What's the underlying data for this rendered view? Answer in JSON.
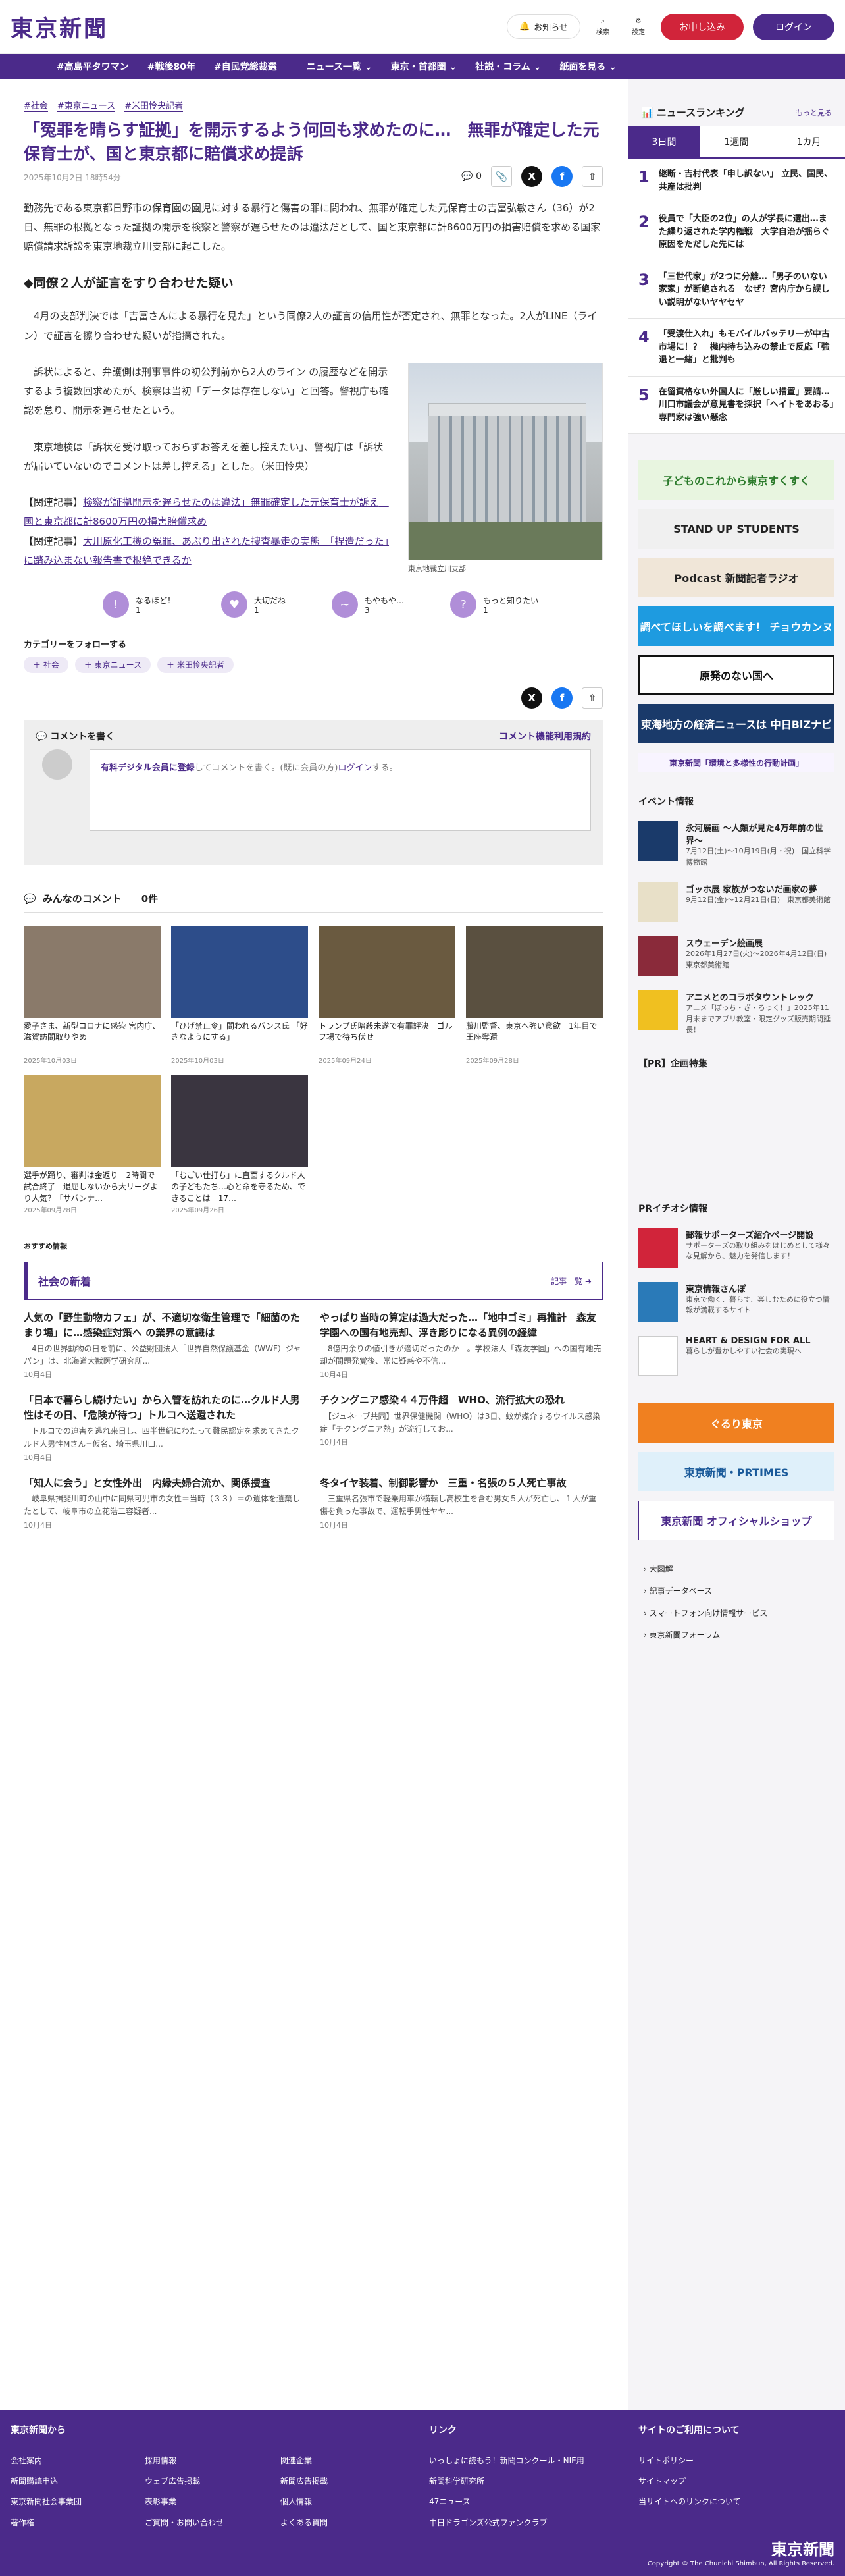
{
  "header": {
    "logo": "東京新聞",
    "notify": "お知らせ",
    "search": "検索",
    "settings": "設定",
    "subscribe": "お申し込み",
    "login": "ログイン"
  },
  "nav": [
    "#高島平タワマン",
    "#戦後80年",
    "#自民党総裁選",
    "ニュース一覧",
    "東京・首都圏",
    "社説・コラム",
    "紙面を見る"
  ],
  "article": {
    "tags": [
      "#社会",
      "#東京ニュース",
      "#米田怜央記者"
    ],
    "title": "「冤罪を晴らす証拠」を開示するよう何回も求めたのに…　無罪が確定した元保育士が、国と東京都に賠償求め提訴",
    "date": "2025年10月2日 18時54分",
    "comments_count": "0",
    "p1": "勤務先である東京都日野市の保育園の園児に対する暴行と傷害の罪に問われ、無罪が確定した元保育士の吉冨弘敏さん（36）が2日、無罪の根拠となった証拠の開示を検察と警察が遅らせたのは違法だとして、国と東京都に計8600万円の損害賠償を求める国家賠償請求訴訟を東京地裁立川支部に起こした。",
    "h2": "◆同僚２人が証言をすり合わせた疑い",
    "p2": "　4月の支部判決では「吉冨さんによる暴行を見た」という同僚2人の証言の信用性が否定され、無罪となった。2人がLINE（ライン）で証言を擦り合わせた疑いが指摘された。",
    "p3": "　訴状によると、弁護側は刑事事件の初公判前から2人のライン の履歴などを開示するよう複数回求めたが、検察は当初「データは存在しない」と回答。警視庁も確認を怠り、開示を遅らせたという。",
    "p4": "　東京地検は「訴状を受け取っておらずお答えを差し控えたい」、警視庁は「訴状が届いていないのでコメントは差し控える」とした。（米田怜央）",
    "caption": "東京地裁立川支部",
    "related_label1": "【関連記事】",
    "related1": "検察が証拠開示を遅らせたのは違法」無罪確定した元保育士が訴え　国と東京都に計8600万円の損害賠償求め",
    "related_label2": "【関連記事】",
    "related2": "大川原化工機の冤罪、あぶり出された捜査暴走の実態　「捏造だった」に踏み込まない報告書で根絶できるか"
  },
  "reactions": [
    {
      "label": "なるほど！",
      "count": "1",
      "icon": "!"
    },
    {
      "label": "大切だね",
      "count": "1",
      "icon": "♥"
    },
    {
      "label": "もやもや…",
      "count": "3",
      "icon": "~"
    },
    {
      "label": "もっと知りたい",
      "count": "1",
      "icon": "?"
    }
  ],
  "category": {
    "heading": "カテゴリーをフォローする",
    "chips": [
      "＋ 社会",
      "＋ 東京ニュース",
      "＋ 米田怜央記者"
    ]
  },
  "comment": {
    "heading": "コメントを書く",
    "policy": "コメント機能利用規約",
    "placeholder_link": "有料デジタル会員に登録",
    "placeholder_rest": "してコメントを書く。(既に会員の方)",
    "login": "ログイン",
    "end": "する。"
  },
  "all_comments": {
    "heading": "みんなのコメント",
    "count": "0件"
  },
  "cards": [
    {
      "title": "愛子さま、新型コロナに感染 宮内庁、滋賀訪問取りやめ",
      "date": "2025年10月03日",
      "color": "#8a7a6a"
    },
    {
      "title": "「ひげ禁止令」問われるバンス氏 「好きなようにする」",
      "date": "2025年10月03日",
      "color": "#2d4d8a"
    },
    {
      "title": "トランプ氏暗殺未遂で有罪評決　ゴルフ場で待ち伏せ",
      "date": "2025年09月24日",
      "color": "#6a5a40"
    },
    {
      "title": "藤川監督、東京へ強い意欲　1年目で王座奪還",
      "date": "2025年09月28日",
      "color": "#5a5040"
    },
    {
      "title": "選手が踊り、審判は金返り　2時間で試合終了　退屈しないから大リーグより人気？「サバンナ…",
      "date": "2025年09月28日",
      "color": "#c8a860"
    },
    {
      "title": "「むごい仕打ち」に直面するクルド人の子どもたち…心と命を守るため、できることは　17…",
      "date": "2025年09月26日",
      "color": "#3a3540"
    }
  ],
  "recommend_label": "おすすめ情報",
  "latest": {
    "heading": "社会の新着",
    "more": "記事一覧",
    "items": [
      {
        "title": "人気の「野生動物カフェ」が、不適切な衛生管理で「細菌のたまり場」に…感染症対策へ の業界の意識は",
        "sub": "　4日の世界動物の日を前に、公益財団法人「世界自然保護基金（WWF）ジャパン」は、北海道大獣医学研究所...",
        "date": "10月4日"
      },
      {
        "title": "やっぱり当時の算定は過大だった…「地中ゴミ」再推計　森友学園への国有地売却、浮き彫りになる異例の経緯",
        "sub": "　8億円余りの値引きが適切だったのか―。学校法人「森友学園」への国有地売却が問題発覚後、常に疑惑や不信...",
        "date": "10月4日"
      },
      {
        "title": "「日本で暮らし続けたい」から入管を訪れたのに…クルド人男性はその日、「危険が待つ」トルコへ送還された",
        "sub": "　トルコでの迫害を逃れ来日し、四半世紀にわたって難民認定を求めてきたクルド人男性Mさん=仮名、埼玉県川口...",
        "date": "10月4日"
      },
      {
        "title": "チクングニア感染４４万件超　WHO、流行拡大の恐れ",
        "sub": "　【ジュネーブ共同】世界保健機関（WHO）は3日、蚊が媒介するウイルス感染症「チクングニア熱」が流行してお...",
        "date": "10月4日"
      },
      {
        "title": "「知人に会う」と女性外出　内縁夫婦合流か、関係捜査",
        "sub": "　岐阜県揖斐川町の山中に同県可児市の女性＝当時（３３）＝の遺体を遺棄したとして、岐阜市の立花浩二容疑者...",
        "date": "10月4日"
      },
      {
        "title": "冬タイヤ装着、制御影響か　三重・名張の５人死亡事故",
        "sub": "　三重県名張市で軽乗用車が横転し高校生を含む男女５人が死亡し、１人が重傷を負った事故で、運転手男性ヤヤ...",
        "date": "10月4日"
      }
    ]
  },
  "sidebar": {
    "ranking_title": "ニュースランキング",
    "ranking_more": "もっと見る",
    "tabs": [
      "3日間",
      "1週間",
      "1カ月"
    ],
    "ranks": [
      "継断・吉村代表「申し訳ない」 立民、国民、共産は批判",
      "役員で「大臣の2位」の人が学長に選出…また繰り返された学内権戦　大学自治が揺らぐ原因をただした先には",
      "「三世代家」が2つに分離…「男子のいない家家」が断絶される　なぜ？宮内庁から誤しい説明がないヤヤセヤ",
      "「受渡仕入れ」もモバイルバッテリーが中古市場に！？　機内持ち込みの禁止で反応「強退と一緒」と批判も",
      "在留資格ない外国人に「厳しい措置」要請…川口市議会が意見書を採択「ヘイトをあおる」専門家は強い懸念"
    ],
    "banners": [
      {
        "text": "子どものこれから東京すくすく",
        "bg": "#e8f5e0",
        "fg": "#2a7a2a"
      },
      {
        "text": "STAND UP STUDENTS",
        "bg": "#f0f0f0",
        "fg": "#222"
      },
      {
        "text": "Podcast 新聞記者ラジオ",
        "bg": "#f0e6d8",
        "fg": "#222"
      },
      {
        "text": "調べてほしいを調べます！ チョウカンヌ",
        "bg": "#1e9be0",
        "fg": "#fff"
      },
      {
        "text": "原発のない国へ",
        "bg": "#fff",
        "fg": "#111"
      },
      {
        "text": "東海地方の経済ニュースは 中日BiZナビ",
        "bg": "#1a3a6a",
        "fg": "#fff"
      },
      {
        "text": "東京新聞「環境と多様性の行動計画」",
        "bg": "#f8f4ff",
        "fg": "#4b2a8a"
      }
    ],
    "events_title": "イベント情報",
    "events": [
      {
        "title": "永河展画 〜人類が見た4万年前の世界〜",
        "desc": "7月12日(土)〜10月19日(月・祝)　国立科学博物館",
        "color": "#1a3a6a"
      },
      {
        "title": "ゴッホ展 家族がつないだ画家の夢",
        "desc": "9月12日(金)〜12月21日(日)　東京都美術館",
        "color": "#e8e0c8"
      },
      {
        "title": "スウェーデン絵画展",
        "desc": "2026年1月27日(火)〜2026年4月12日(日)　東京都美術館",
        "color": "#8a2a3a"
      },
      {
        "title": "アニメとのコラボタウントレック",
        "desc": "アニメ「ぼっち・ざ・ろっく！」2025年11月末までアプリ教室・限定グッズ販売期間延長！",
        "color": "#f0c020"
      }
    ],
    "pr_title": "【PR】企画特集",
    "prinfo_title": "PRイチオシ情報",
    "prinfo": [
      {
        "title": "郵報サポーターズ紹介ページ開設",
        "desc": "サポーターズの取り組みをはじめとして様々な見解から、魅力を発信します！",
        "color": "#d1243a"
      },
      {
        "title": "東京情報さんぽ",
        "desc": "東京で働く、暮らす、楽しむために役立つ情報が満載するサイト",
        "color": "#2a7ab8"
      },
      {
        "title": "HEART & DESIGN FOR ALL",
        "desc": "暮らしが豊かしやすい社会の実現へ",
        "color": "#f5f5f5"
      }
    ],
    "banners2": [
      {
        "text": "ぐるり東京",
        "bg": "#f08020",
        "fg": "#fff"
      },
      {
        "text": "東京新聞・PRTIMES",
        "bg": "#dff0fa",
        "fg": "#1a5a9a"
      },
      {
        "text": "東京新聞 オフィシャルショップ",
        "bg": "#fff",
        "fg": "#4b2a8a"
      }
    ],
    "links": [
      "大図解",
      "記事データベース",
      "スマートフォン向け情報サービス",
      "東京新聞フォーラム"
    ]
  },
  "footer": {
    "col1_title": "東京新聞から",
    "col1": [
      "会社案内",
      "新聞購読申込",
      "東京新聞社会事業団",
      "著作権"
    ],
    "col1b": [
      "採用情報",
      "ウェブ広告掲載",
      "表彰事業",
      "ご質問・お問い合わせ"
    ],
    "col1c": [
      "関連企業",
      "新聞広告掲載",
      "個人情報",
      "よくある質問"
    ],
    "col2_title": "リンク",
    "col2": [
      "いっしょに読もう！新聞コンクール・NIE用",
      "新聞科学研究所",
      "47ニュース",
      "中日ドラゴンズ公式ファンクラブ"
    ],
    "col3_title": "サイトのご利用について",
    "col3": [
      "サイトポリシー",
      "サイトマップ",
      "当サイトへのリンクについて"
    ],
    "logo": "東京新聞",
    "copyright": "Copyright © The Chunichi Shimbun, All Rights Reserved."
  }
}
